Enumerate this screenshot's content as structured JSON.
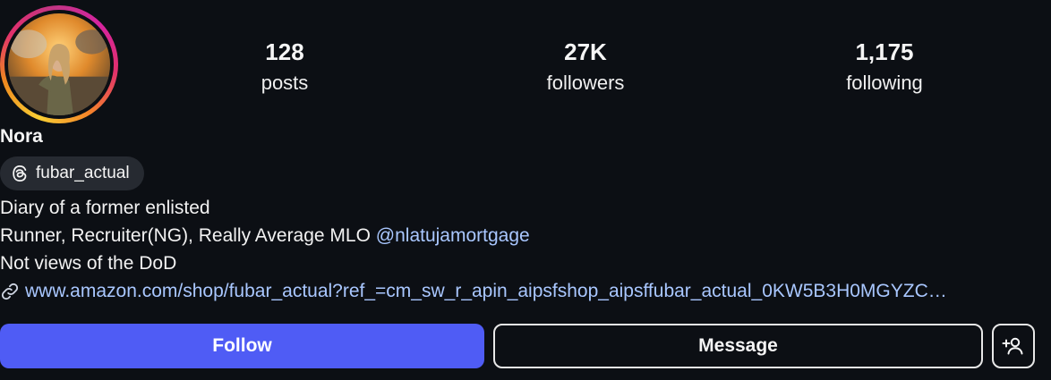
{
  "profile": {
    "name": "Nora",
    "threads_handle": "fubar_actual"
  },
  "stats": {
    "posts": {
      "value": "128",
      "label": "posts"
    },
    "followers": {
      "value": "27K",
      "label": "followers"
    },
    "following": {
      "value": "1,175",
      "label": "following"
    }
  },
  "bio": {
    "line1": "Diary of a former enlisted",
    "line2_text": "Runner, Recruiter(NG), Really Average MLO ",
    "line2_mention": "@nlatujamortgage",
    "line3": "Not views of the DoD",
    "link": "www.amazon.com/shop/fubar_actual?ref_=cm_sw_r_apin_aipsfshop_aipsffubar_actual_0KW5B3H0MGYZC…"
  },
  "actions": {
    "follow_label": "Follow",
    "message_label": "Message"
  },
  "icons": {
    "threads": "threads-icon",
    "link": "link-icon",
    "suggest": "add-person-icon"
  },
  "colors": {
    "background": "#0c0f14",
    "follow_button": "#4f5cf5",
    "link": "#a9c7ff",
    "chip": "#262a31"
  }
}
